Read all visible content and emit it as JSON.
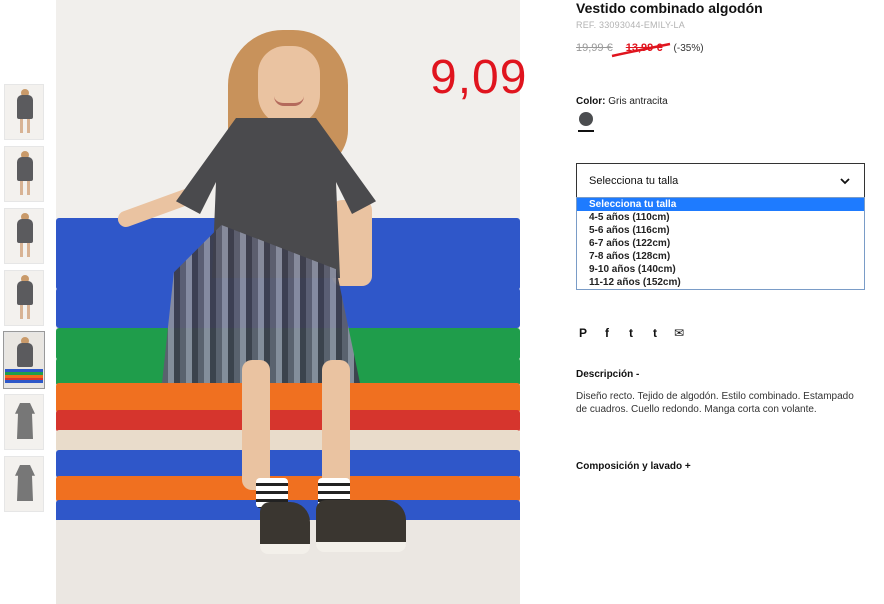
{
  "product": {
    "title": "Vestido combinado algodón",
    "ref": "REF. 33093044-EMILY-LA",
    "old_price": "19,99 €",
    "sale_price": "13,99 €",
    "discount": "(-35%)"
  },
  "annotation": {
    "handwritten_price": "9,09",
    "color": "#e0141e"
  },
  "color": {
    "label": "Color:",
    "value": "Gris antracita",
    "swatch_hex": "#4b4d50"
  },
  "size": {
    "placeholder": "Selecciona tu talla",
    "options": [
      "Selecciona tu talla",
      "4-5 años (110cm)",
      "5-6 años (116cm)",
      "6-7 años (122cm)",
      "7-8 años (128cm)",
      "9-10 años (140cm)",
      "11-12 años (152cm)"
    ],
    "highlighted_index": 0
  },
  "share": {
    "icons": [
      "pinterest-icon",
      "facebook-icon",
      "twitter-icon",
      "tumblr-icon",
      "email-icon"
    ],
    "glyphs": [
      "P",
      "f",
      "t",
      "t",
      "✉"
    ]
  },
  "description": {
    "title": "Descripción -",
    "text": "Diseño recto. Tejido de algodón. Estilo combinado. Estampado de cuadros. Cuello redondo. Manga corta con volante."
  },
  "composition": {
    "title": "Composición y lavado +"
  },
  "mat_colors": [
    "#2f57c9",
    "#2f57c9",
    "#1f9d4b",
    "#1f9d4b",
    "#f07020",
    "#d6352d",
    "#e9dccb",
    "#2f57c9",
    "#f07020",
    "#2f57c9"
  ]
}
